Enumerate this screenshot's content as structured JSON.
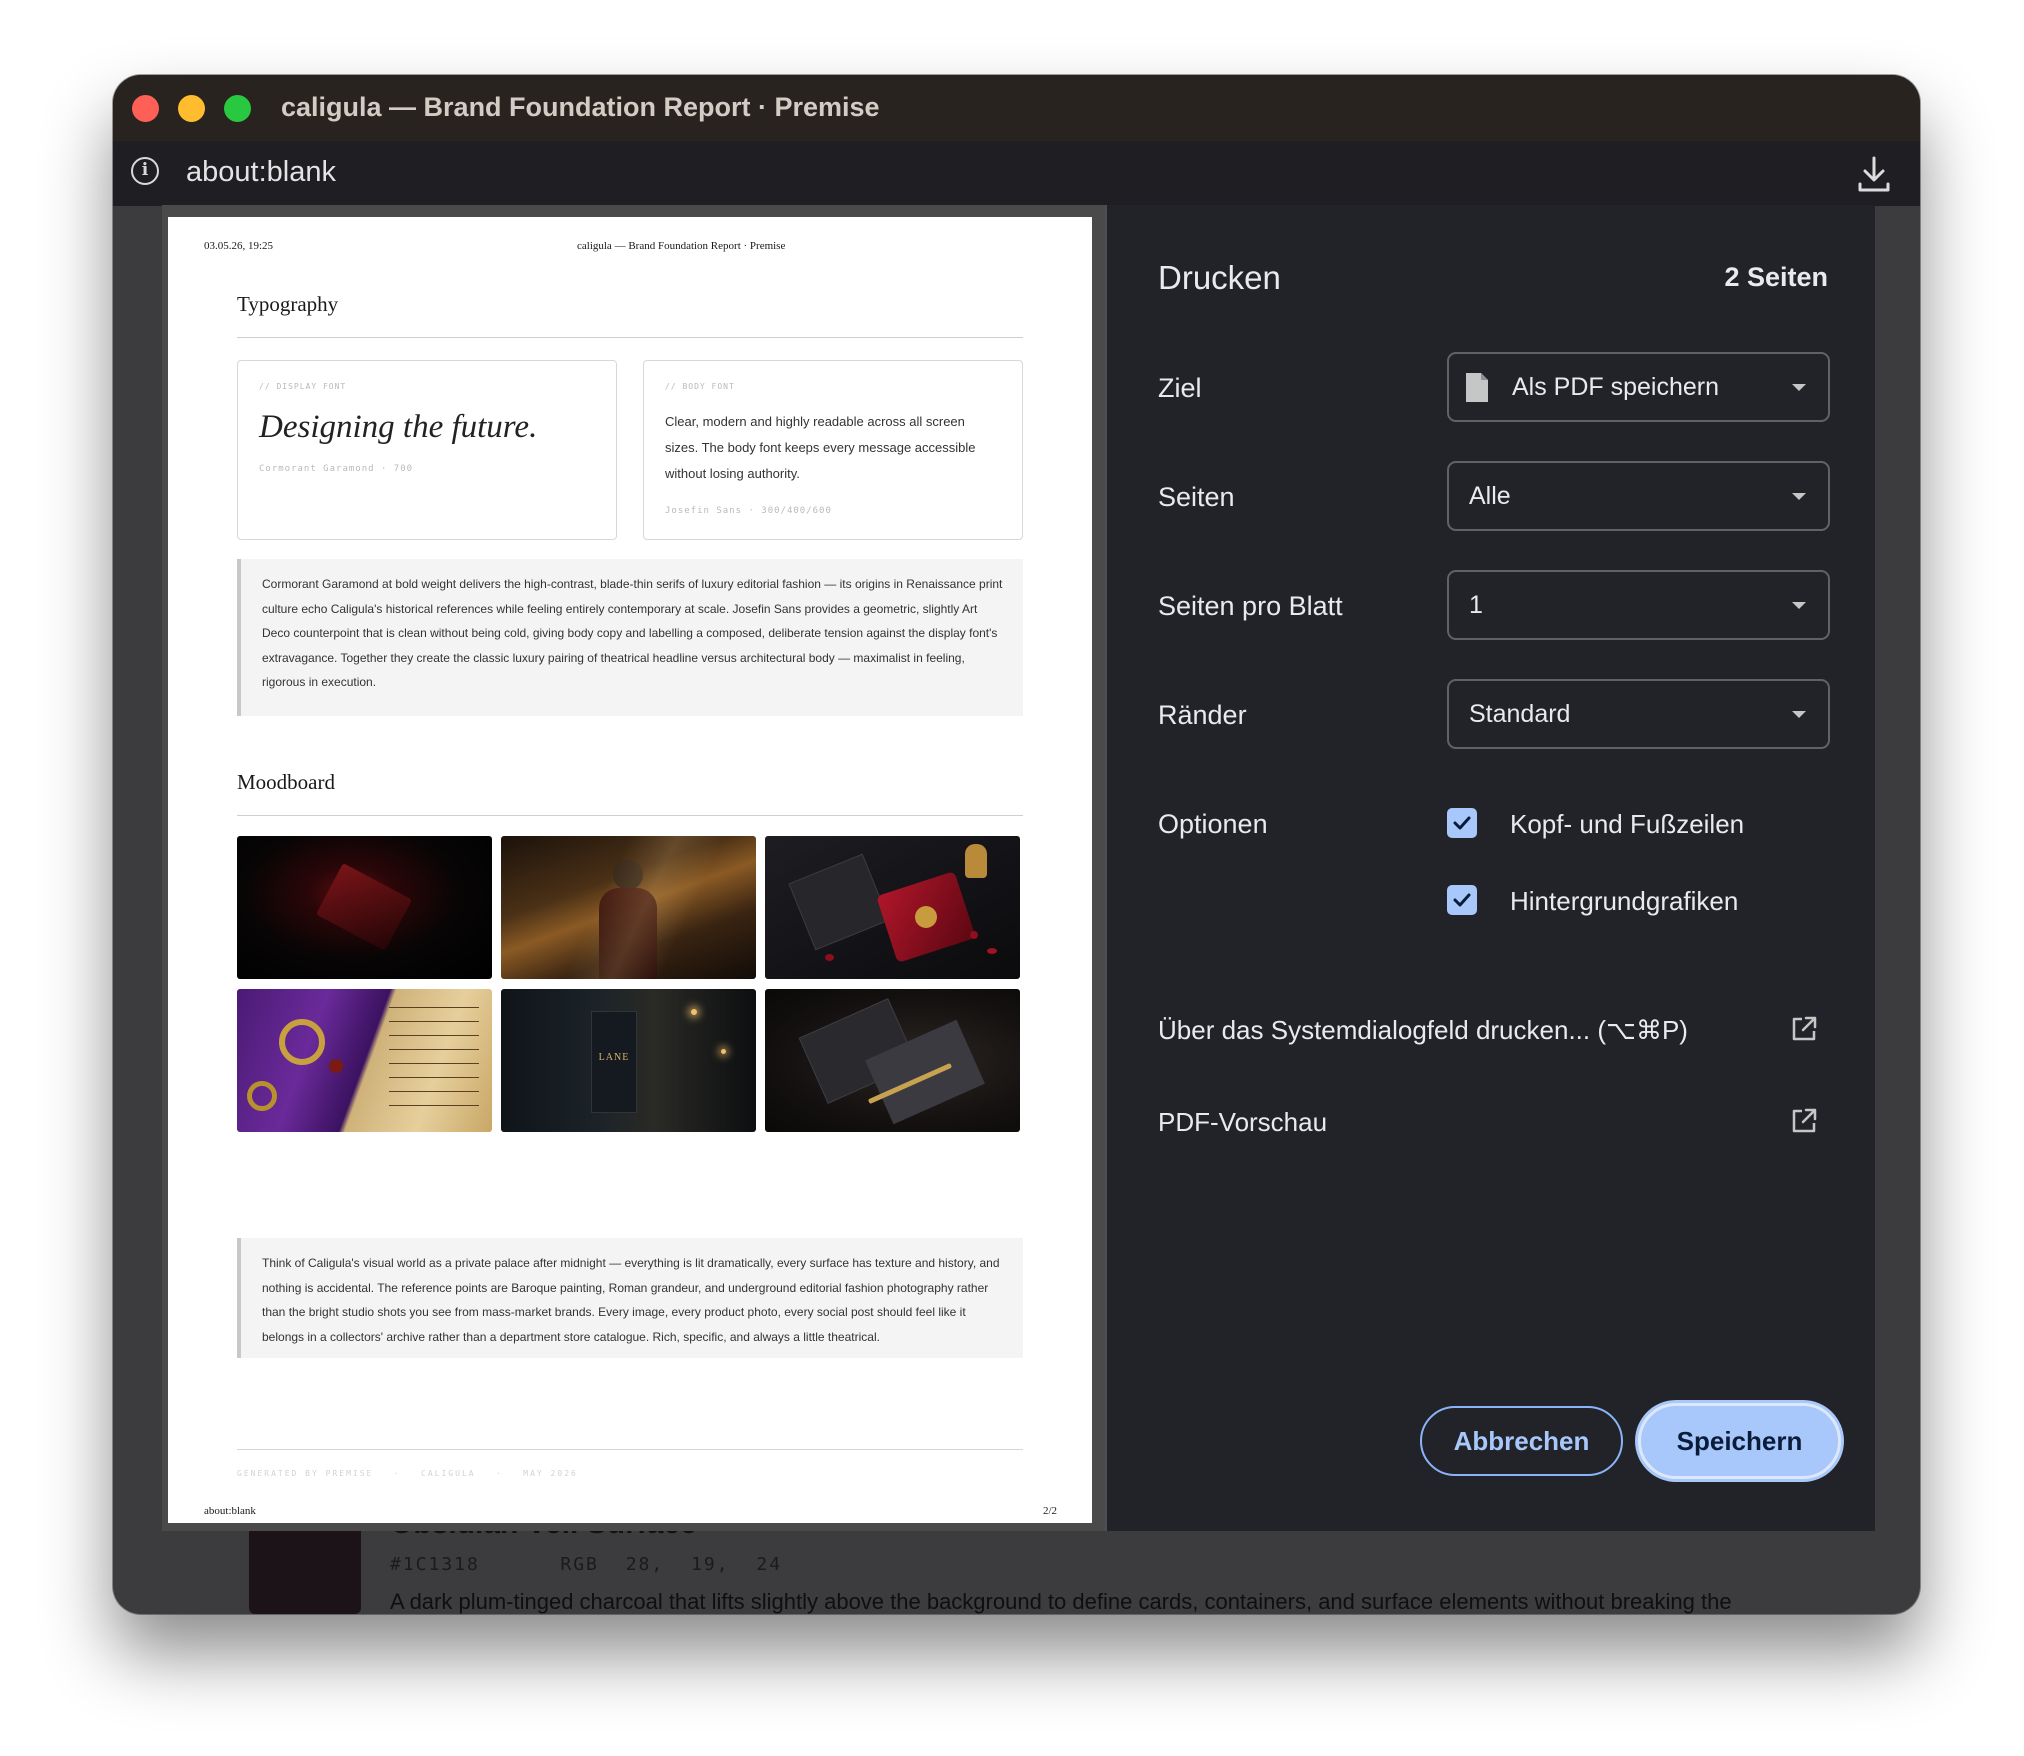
{
  "window": {
    "title": "caligula — Brand Foundation Report · Premise",
    "url": "about:blank"
  },
  "background_page": {
    "swatch_color": "#1C1318",
    "name": "Obsidian Veil  Surface",
    "hex": "#1C1318",
    "rgb": "RGB 28, 19, 24",
    "description": "A dark plum-tinged charcoal that lifts slightly above the background to define cards, containers, and surface elements without breaking the"
  },
  "preview": {
    "timestamp": "03.05.26, 19:25",
    "header": "caligula — Brand Foundation Report · Premise",
    "typography": {
      "heading": "Typography",
      "display_label": "// DISPLAY FONT",
      "display_sample": "Designing the future.",
      "display_meta": "Cormorant Garamond · 700",
      "body_label": "// BODY FONT",
      "body_sample": "Clear, modern and highly readable across all screen sizes. The body font keeps every message accessible without losing authority.",
      "body_meta": "Josefin Sans · 300/400/600",
      "note": "Cormorant Garamond at bold weight delivers the high-contrast, blade-thin serifs of luxury editorial fashion — its origins in Renaissance print culture echo Caligula's historical references while feeling entirely contemporary at scale. Josefin Sans provides a geometric, slightly Art Deco counterpoint that is clean without being cold, giving body copy and labelling a composed, deliberate tension against the display font's extravagance. Together they create the classic luxury pairing of theatrical headline versus architectural body — maximalist in feeling, rigorous in execution."
    },
    "moodboard": {
      "heading": "Moodboard",
      "tiles": [
        {
          "name": "red-lacquer-menu-image"
        },
        {
          "name": "candlelit-palace-figure-image"
        },
        {
          "name": "wax-seal-stationery-image"
        },
        {
          "name": "baroque-embroidery-parchment-image"
        },
        {
          "name": "lane-night-sign-image",
          "text": "LANE"
        },
        {
          "name": "dark-envelope-pen-image"
        }
      ],
      "note": "Think of Caligula's visual world as a private palace after midnight — everything is lit dramatically, every surface has texture and history, and nothing is accidental. The reference points are Baroque painting, Roman grandeur, and underground editorial fashion photography rather than the bright studio shots you see from mass-market brands. Every image, every product photo, every social post should feel like it belongs in a collectors' archive rather than a department store catalogue. Rich, specific, and always a little theatrical."
    },
    "generated": "GENERATED BY PREMISE   ·   CALIGULA   ·   MAY 2026",
    "footer_left": "about:blank",
    "footer_right": "2/2"
  },
  "print": {
    "title": "Drucken",
    "page_count": "2 Seiten",
    "destination_label": "Ziel",
    "destination_value": "Als PDF speichern",
    "pages_label": "Seiten",
    "pages_value": "Alle",
    "per_sheet_label": "Seiten pro Blatt",
    "per_sheet_value": "1",
    "margins_label": "Ränder",
    "margins_value": "Standard",
    "options_label": "Optionen",
    "option_headers_footers": "Kopf- und Fußzeilen",
    "option_headers_footers_checked": true,
    "option_background": "Hintergrundgrafiken",
    "option_background_checked": true,
    "system_dialog": "Über das Systemdialogfeld drucken... (⌥⌘P)",
    "pdf_preview": "PDF-Vorschau",
    "cancel": "Abbrechen",
    "save": "Speichern",
    "accent_color": "#A8C7FA"
  }
}
